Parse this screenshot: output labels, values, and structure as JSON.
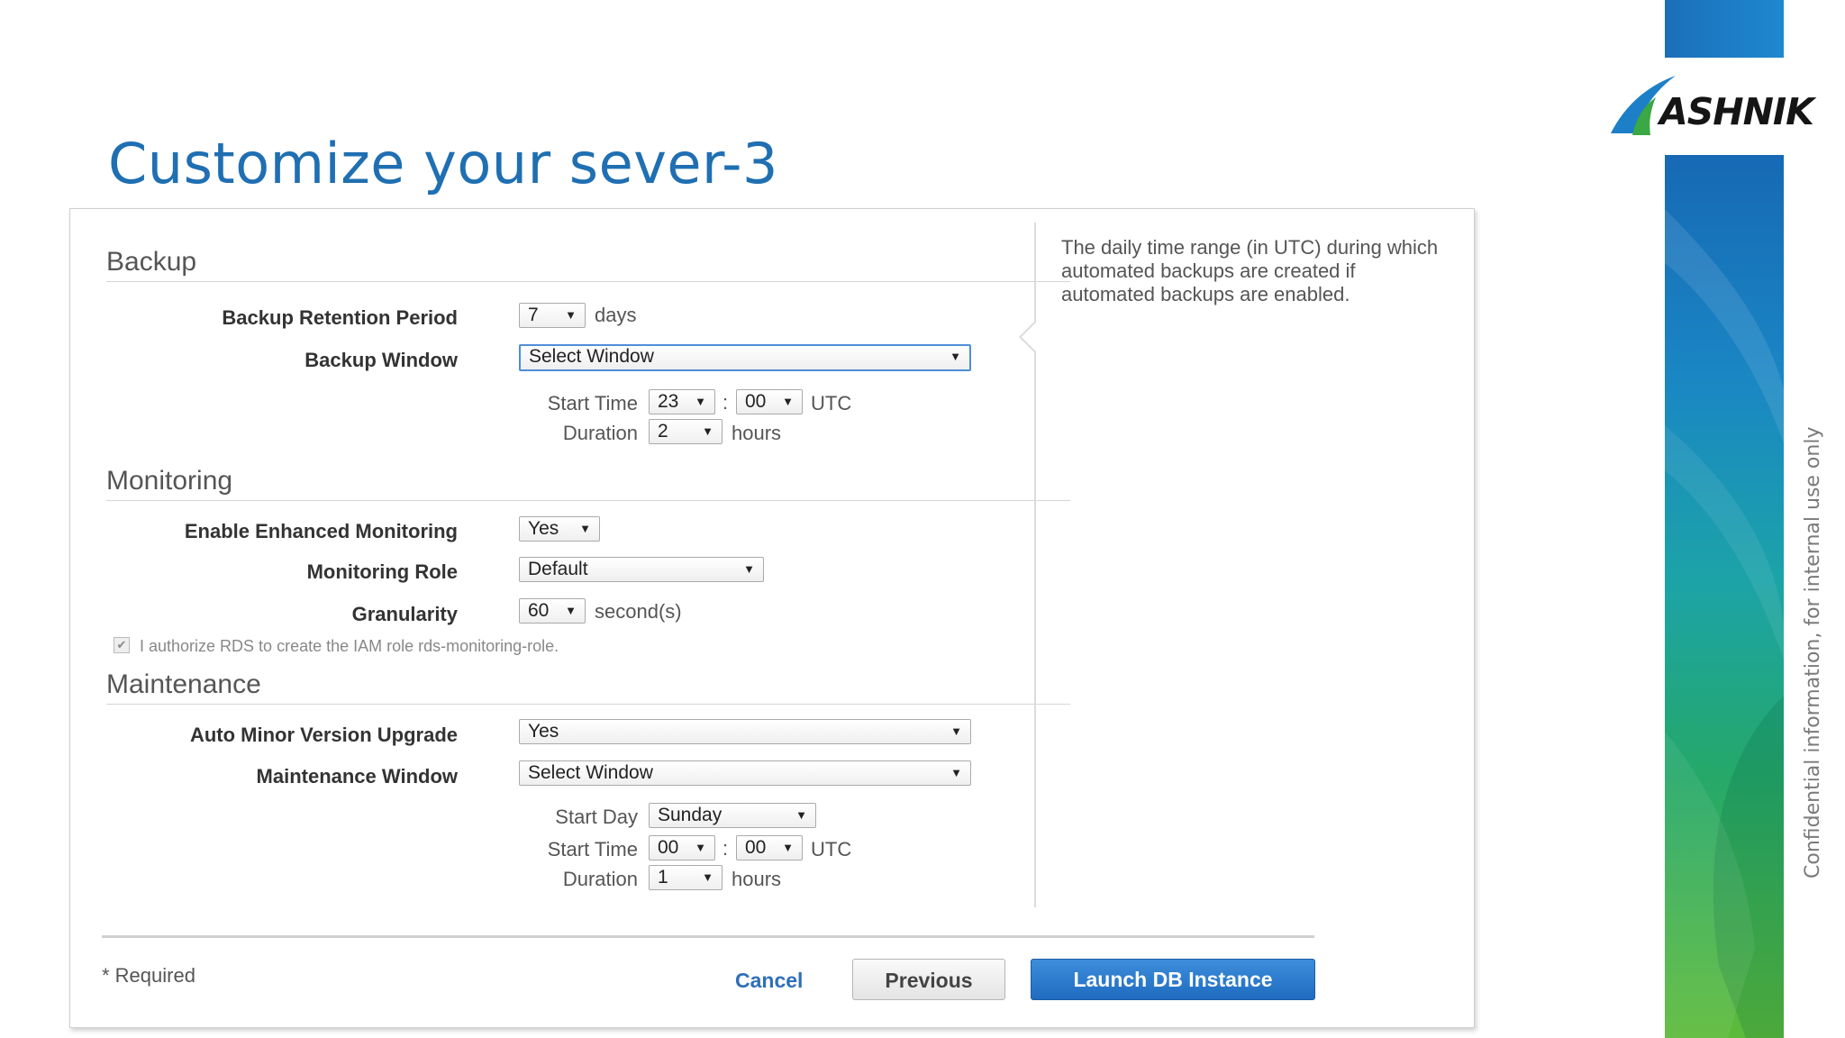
{
  "slide": {
    "title": "Customize your sever-3",
    "logo_text": "ASHNIK",
    "confidential_note": "Confidential information, for internal use only"
  },
  "backup": {
    "section_title": "Backup",
    "retention_label": "Backup Retention Period",
    "retention_value": "7",
    "retention_unit": "days",
    "window_label": "Backup Window",
    "window_value": "Select Window",
    "start_time_label": "Start Time",
    "start_hour": "23",
    "start_minute": "00",
    "start_tz": "UTC",
    "duration_label": "Duration",
    "duration_value": "2",
    "duration_unit": "hours"
  },
  "monitoring": {
    "section_title": "Monitoring",
    "enhanced_label": "Enable Enhanced Monitoring",
    "enhanced_value": "Yes",
    "role_label": "Monitoring Role",
    "role_value": "Default",
    "granularity_label": "Granularity",
    "granularity_value": "60",
    "granularity_unit": "second(s)",
    "authorize_text": "I authorize RDS to create the IAM role rds-monitoring-role."
  },
  "maintenance": {
    "section_title": "Maintenance",
    "auto_upgrade_label": "Auto Minor Version Upgrade",
    "auto_upgrade_value": "Yes",
    "window_label": "Maintenance Window",
    "window_value": "Select Window",
    "start_day_label": "Start Day",
    "start_day_value": "Sunday",
    "start_time_label": "Start Time",
    "start_hour": "00",
    "start_minute": "00",
    "start_tz": "UTC",
    "duration_label": "Duration",
    "duration_value": "1",
    "duration_unit": "hours"
  },
  "help": {
    "text": "The daily time range (in UTC) during which automated backups are created if automated backups are enabled."
  },
  "footer": {
    "required_note": "* Required",
    "cancel_label": "Cancel",
    "previous_label": "Previous",
    "launch_label": "Launch DB Instance"
  },
  "colors": {
    "title_blue": "#1f6fb2",
    "launch_button": "#1f6cc0",
    "focus_border": "#4e8fd6"
  },
  "icons": {
    "dropdown": "caret-down-icon",
    "checkbox": "checkmark-icon",
    "logo": "ashnik-swoosh-logo"
  }
}
